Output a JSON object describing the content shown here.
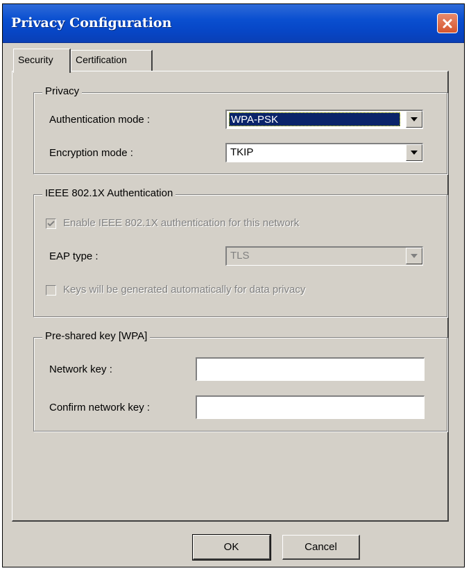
{
  "window": {
    "title": "Privacy Configuration"
  },
  "tabs": [
    {
      "label": "Security",
      "active": true
    },
    {
      "label": "Certification",
      "active": false
    }
  ],
  "privacy": {
    "legend": "Privacy",
    "auth_mode_label": "Authentication mode :",
    "auth_mode_value": "WPA-PSK",
    "encryption_mode_label": "Encryption mode :",
    "encryption_mode_value": "TKIP"
  },
  "ieee": {
    "legend": "IEEE 802.1X Authentication",
    "enable_label": "Enable IEEE 802.1X authentication for this network",
    "enable_checked": true,
    "eap_type_label": "EAP type :",
    "eap_type_value": "TLS",
    "keys_label": "Keys will be generated automatically for data privacy",
    "keys_checked": false
  },
  "psk": {
    "legend": "Pre-shared key [WPA]",
    "network_key_label": "Network key :",
    "network_key_value": "",
    "confirm_key_label": "Confirm network key :",
    "confirm_key_value": ""
  },
  "buttons": {
    "ok": "OK",
    "cancel": "Cancel"
  },
  "icons": {
    "close": "close-icon",
    "dropdown": "chevron-down-icon",
    "check": "checkmark-icon"
  },
  "colors": {
    "titlebar": "#0a4fd0",
    "dialog_bg": "#d4d0c8",
    "selection": "#0a246a",
    "close_button": "#d5552e"
  }
}
